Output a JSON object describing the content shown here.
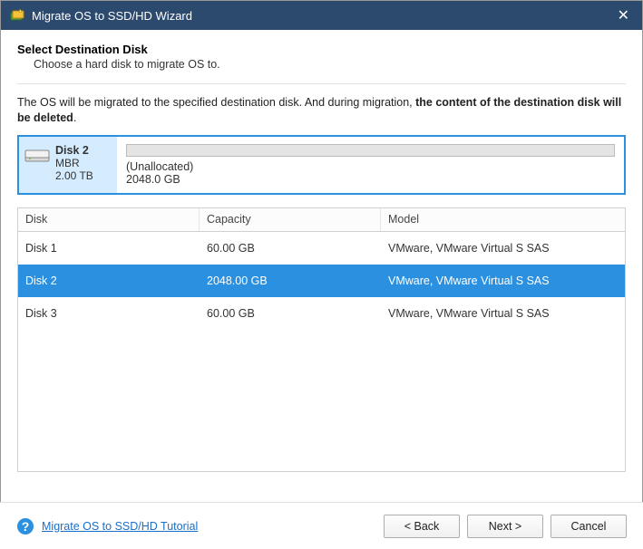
{
  "window": {
    "title": "Migrate OS to SSD/HD Wizard"
  },
  "header": {
    "heading": "Select Destination Disk",
    "subheading": "Choose a hard disk to migrate OS to."
  },
  "warning": {
    "prefix": "The OS will be migrated to the specified destination disk. And during migration, ",
    "bold": "the content of the destination disk will be deleted",
    "suffix": "."
  },
  "preview": {
    "disk_name": "Disk 2",
    "disk_type": "MBR",
    "disk_size": "2.00 TB",
    "unallocated_label": "(Unallocated)",
    "unallocated_size": "2048.0 GB"
  },
  "table": {
    "cols": {
      "disk": "Disk",
      "capacity": "Capacity",
      "model": "Model"
    },
    "rows": [
      {
        "disk": "Disk 1",
        "capacity": "60.00 GB",
        "model": "VMware, VMware Virtual S SAS",
        "selected": false
      },
      {
        "disk": "Disk 2",
        "capacity": "2048.00 GB",
        "model": "VMware, VMware Virtual S SAS",
        "selected": true
      },
      {
        "disk": "Disk 3",
        "capacity": "60.00 GB",
        "model": "VMware, VMware Virtual S SAS",
        "selected": false
      }
    ]
  },
  "footer": {
    "tutorial_link": "Migrate OS to SSD/HD Tutorial",
    "back": "< Back",
    "next": "Next >",
    "cancel": "Cancel"
  }
}
